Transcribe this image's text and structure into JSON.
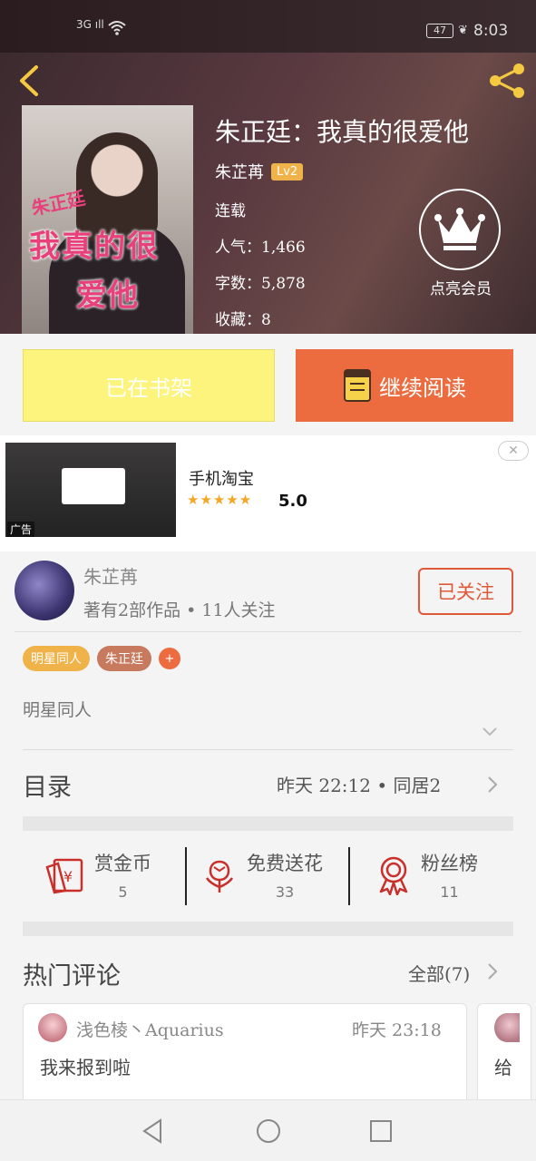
{
  "status_bar": {
    "network": "3G",
    "battery": "47",
    "time": "8:03"
  },
  "book": {
    "title": "朱正廷：我真的很爱他",
    "cover_text_line1": "朱正廷",
    "cover_text_line2": "我真的很",
    "cover_text_line3": "爱他",
    "author": "朱芷苒",
    "author_level": "Lv2",
    "status": "连载",
    "popularity": "人气：1,466",
    "word_count": "字数：5,878",
    "favorites": "收藏：8"
  },
  "vip": {
    "label": "点亮会员"
  },
  "actions": {
    "shelf_label": "已在书架",
    "read_label": "继续阅读"
  },
  "ad": {
    "title": "手机淘宝",
    "stars": "★★★★★",
    "rating": "5.0",
    "tag": "广告",
    "close": "✕"
  },
  "author_panel": {
    "name": "朱芷苒",
    "stats": "著有2部作品 • 11人关注",
    "follow_label": "已关注",
    "tags": [
      {
        "label": "明星同人",
        "color": "#f0b34a"
      },
      {
        "label": "朱正廷",
        "color": "#c77a5e"
      }
    ],
    "tag_add": "+",
    "intro": "明星同人"
  },
  "toc": {
    "label": "目录",
    "latest": "昨天 22:12 • 同居2"
  },
  "gifts": [
    {
      "label": "赏金币",
      "count": "5",
      "icon": "red-envelope-icon"
    },
    {
      "label": "免费送花",
      "count": "33",
      "icon": "flower-icon"
    },
    {
      "label": "粉丝榜",
      "count": "11",
      "icon": "medal-icon"
    }
  ],
  "comments": {
    "title": "热门评论",
    "all_label": "全部(7)",
    "items": [
      {
        "user": "浅色棱丶Aquarius",
        "time": "昨天 23:18",
        "text": "我来报到啦"
      },
      {
        "text": "给"
      }
    ]
  },
  "colors": {
    "accent": "#ec6b3f",
    "shelf": "#fdf47e",
    "follow": "#e0583a",
    "icon_red": "#c9302c"
  }
}
